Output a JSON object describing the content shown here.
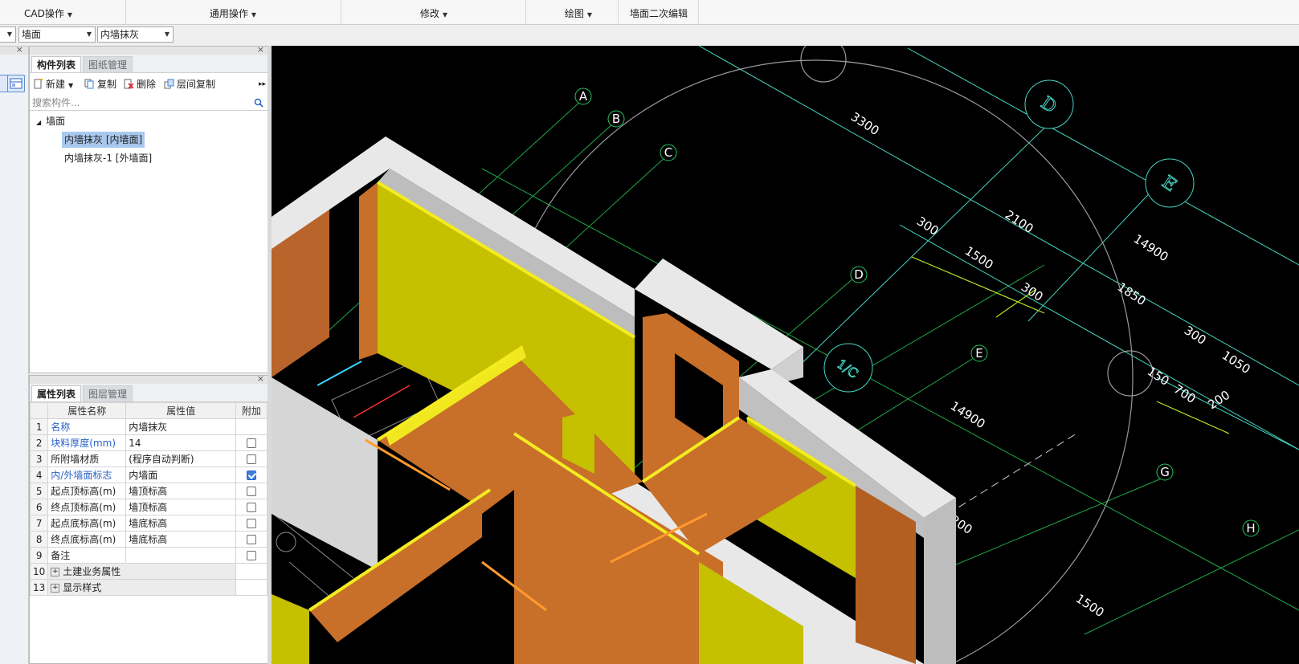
{
  "ribbon": {
    "groups": [
      {
        "label": "CAD操作",
        "has_dropdown": true
      },
      {
        "label": "通用操作",
        "has_dropdown": true
      },
      {
        "label": "修改",
        "has_dropdown": true
      },
      {
        "label": "绘图",
        "has_dropdown": true
      },
      {
        "label": "墙面二次编辑",
        "has_dropdown": false
      }
    ]
  },
  "combobar": {
    "combo_type": "墙面",
    "combo_component": "内墙抹灰"
  },
  "component_panel": {
    "tabs": [
      "构件列表",
      "图纸管理"
    ],
    "active_tab": 0,
    "toolbar": {
      "new_label": "新建",
      "copy_label": "复制",
      "delete_label": "删除",
      "floor_copy_label": "层间复制"
    },
    "search": {
      "placeholder": "搜索构件..."
    },
    "tree": {
      "root": "墙面",
      "items": [
        "内墙抹灰 [内墙面]",
        "内墙抹灰-1 [外墙面]"
      ],
      "selected_index": 0
    }
  },
  "property_panel": {
    "tabs": [
      "属性列表",
      "图层管理"
    ],
    "active_tab": 0,
    "headers": [
      "属性名称",
      "属性值",
      "附加"
    ],
    "rows": [
      {
        "num": "1",
        "name": "名称",
        "value": "内墙抹灰",
        "blue": true,
        "checkbox": "none"
      },
      {
        "num": "2",
        "name": "块料厚度(mm)",
        "value": "14",
        "blue": true,
        "checkbox": "off"
      },
      {
        "num": "3",
        "name": "所附墙材质",
        "value": "(程序自动判断)",
        "blue": false,
        "checkbox": "off"
      },
      {
        "num": "4",
        "name": "内/外墙面标志",
        "value": "内墙面",
        "blue": true,
        "checkbox": "on"
      },
      {
        "num": "5",
        "name": "起点顶标高(m)",
        "value": "墙顶标高",
        "blue": false,
        "checkbox": "off"
      },
      {
        "num": "6",
        "name": "终点顶标高(m)",
        "value": "墙顶标高",
        "blue": false,
        "checkbox": "off"
      },
      {
        "num": "7",
        "name": "起点底标高(m)",
        "value": "墙底标高",
        "blue": false,
        "checkbox": "off"
      },
      {
        "num": "8",
        "name": "终点底标高(m)",
        "value": "墙底标高",
        "blue": false,
        "checkbox": "off"
      },
      {
        "num": "9",
        "name": "备注",
        "value": "",
        "blue": false,
        "checkbox": "off"
      }
    ],
    "groups": [
      {
        "num": "10",
        "name": "土建业务属性"
      },
      {
        "num": "13",
        "name": "显示样式"
      }
    ]
  },
  "viewport": {
    "axis_labels": [
      "A",
      "B",
      "C",
      "D",
      "E",
      "G",
      "H"
    ],
    "rotated_axis_labels": [
      "D",
      "E",
      "1/C"
    ],
    "dimensions": [
      "3300",
      "300",
      "2100",
      "1500",
      "300",
      "14900",
      "1850",
      "300",
      "1050",
      "150",
      "700",
      "200",
      "14900",
      "200",
      "1500"
    ],
    "colors": {
      "background": "#000000",
      "grid_green": "#22c55e",
      "dim_cyan": "#5fe1d6",
      "wall_orange": "#c8702a",
      "wall_yellow": "#c8c400",
      "wall_top": "#e2e2e2"
    }
  }
}
